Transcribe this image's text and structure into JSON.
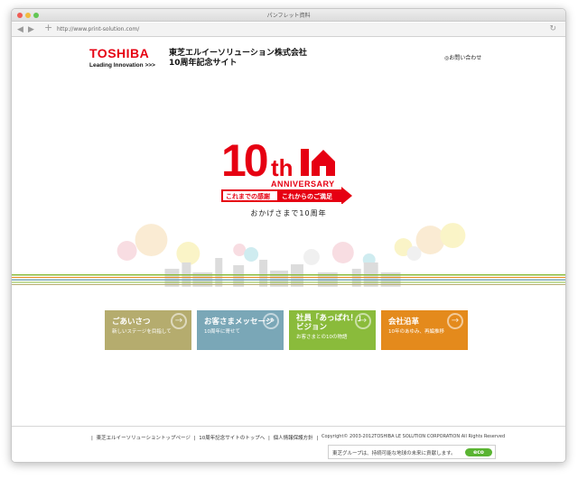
{
  "browser": {
    "window_title": "パンフレット資料",
    "url": "http://www.print-solution.com/",
    "back_icon": "back-arrow-icon",
    "forward_icon": "forward-arrow-icon",
    "new_tab_icon": "plus-icon",
    "reload_icon": "reload-icon"
  },
  "header": {
    "brand": "TOSHIBA",
    "brand_tagline": "Leading Innovation",
    "brand_tagline_mark": ">>>",
    "company_line1": "東芝エルイーソリューション株式会社",
    "company_line2": "10周年記念サイト",
    "contact_label": "お問い合わせ",
    "contact_mark": "◎"
  },
  "hero": {
    "logo_number": "10",
    "logo_suffix": "th",
    "logo_anniversary": "ANNIVERSARY",
    "logo_left_label": "これまでの感謝",
    "logo_right_label": "これからのご満足",
    "tagline": "おかげさまで10周年"
  },
  "cards": [
    {
      "title": "ごあいさつ",
      "subtitle": "新しいステージを目指して",
      "color": "#b5ac6e"
    },
    {
      "title": "お客さまメッセージ",
      "subtitle": "10周年に寄せて",
      "color": "#7aa7b7"
    },
    {
      "title": "社員「あっぱれ！」",
      "title2": "ビジョン",
      "subtitle": "お客さまとの10の物語",
      "color": "#8abb3b"
    },
    {
      "title": "会社沿革",
      "subtitle": "10年のあゆみ、再編推移",
      "color": "#e48a1c"
    }
  ],
  "footer": {
    "link1": "東芝エルイーソリューショントップページ",
    "link2": "10周年記念サイトのトップへ",
    "link3": "個人情報保護方針",
    "copyright": "Copyright© 2003-2012TOSHIBA LE SOLUTION CORPORATION All Rights Reserved",
    "eco_text": "東芝グループは、持続可能な地球の未来に貢献します。",
    "eco_badge": "eco"
  },
  "colors": {
    "brand_red": "#e60012",
    "stripe_green": "#8abb3b",
    "stripe_blue": "#7aa7b7",
    "stripe_orange": "#e48a1c"
  }
}
